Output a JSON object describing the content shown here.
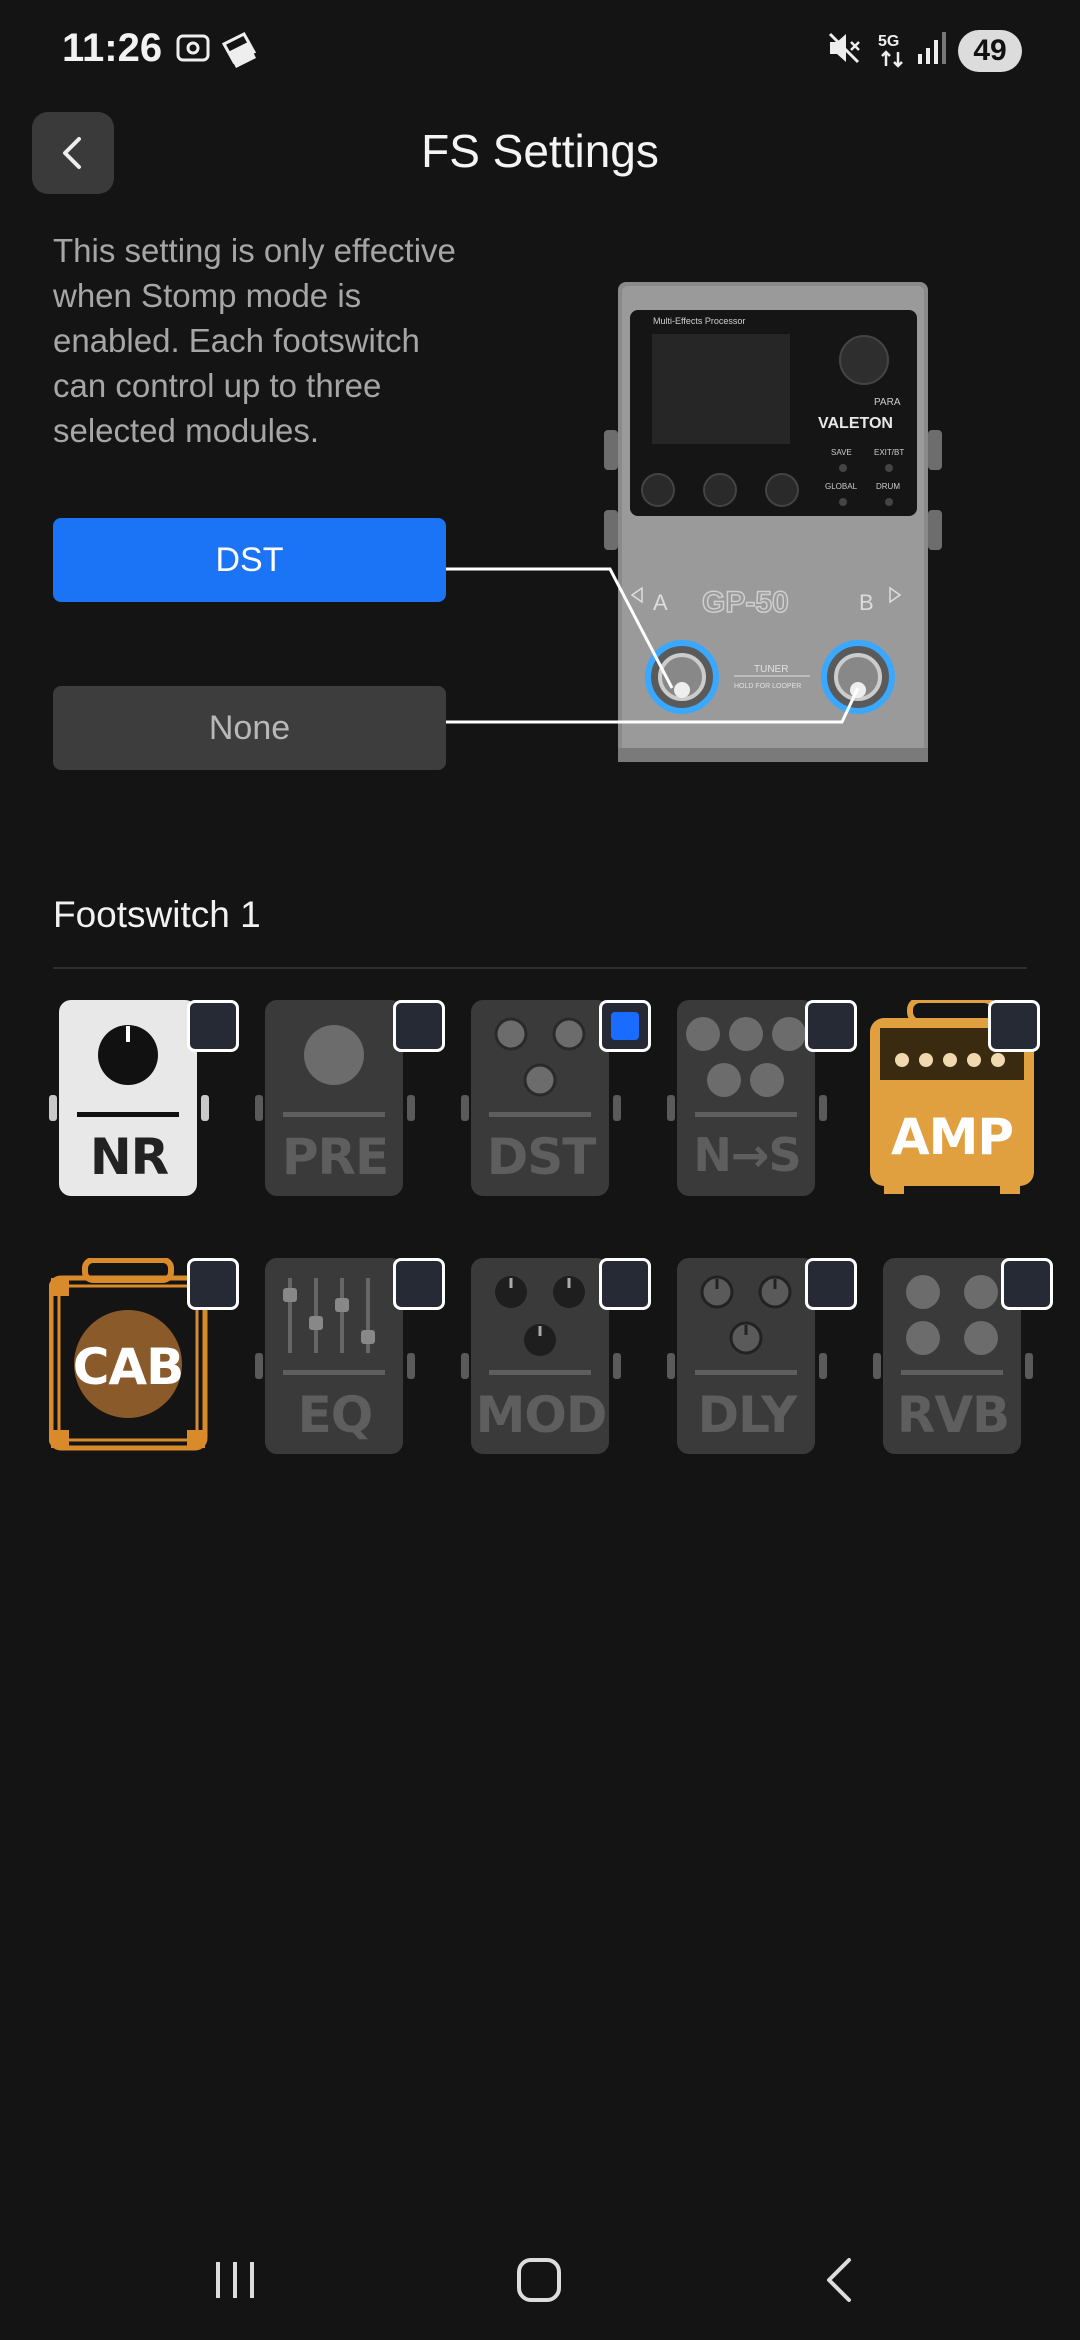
{
  "status_bar": {
    "time": "11:26",
    "battery": "49"
  },
  "header": {
    "title": "FS Settings"
  },
  "description": "This setting is only effective when Stomp mode is enabled. Each footswitch can control up to three selected modules.",
  "footswitch_buttons": [
    {
      "label": "DST",
      "active": true
    },
    {
      "label": "None",
      "active": false
    }
  ],
  "pedal": {
    "caption": "Multi-Effects Processor",
    "brand": "VALETON",
    "para": "PARA",
    "model": "GP-50",
    "save": "SAVE",
    "exit_bt": "EXIT/BT",
    "global": "GLOBAL",
    "drum": "DRUM",
    "tuner": "TUNER",
    "hold": "HOLD FOR LOOPER",
    "a": "A",
    "b": "B"
  },
  "section": {
    "title": "Footswitch 1"
  },
  "modules": [
    {
      "label": "NR",
      "checked": false,
      "enabled": true
    },
    {
      "label": "PRE",
      "checked": false,
      "enabled": false
    },
    {
      "label": "DST",
      "checked": true,
      "enabled": false
    },
    {
      "label": "N→S",
      "checked": false,
      "enabled": false
    },
    {
      "label": "AMP",
      "checked": false,
      "enabled": true
    },
    {
      "label": "CAB",
      "checked": false,
      "enabled": true
    },
    {
      "label": "EQ",
      "checked": false,
      "enabled": false
    },
    {
      "label": "MOD",
      "checked": false,
      "enabled": false
    },
    {
      "label": "DLY",
      "checked": false,
      "enabled": false
    },
    {
      "label": "RVB",
      "checked": false,
      "enabled": false
    }
  ],
  "colors": {
    "accent": "#1a74f5",
    "amp_orange": "#e0a040",
    "cab_orange": "#d98a2a",
    "background": "#141414"
  }
}
